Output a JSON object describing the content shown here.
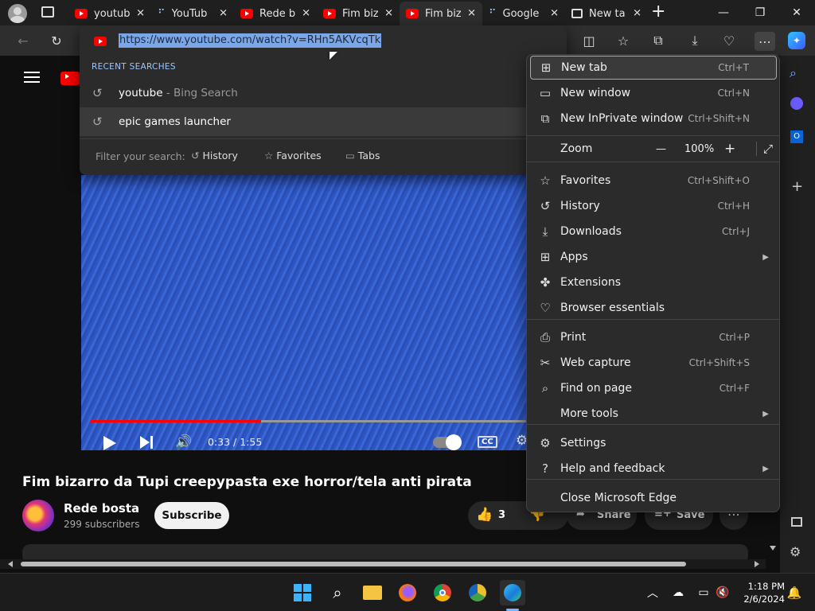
{
  "tabs": [
    {
      "label": "youtub",
      "icon": "youtube-icon"
    },
    {
      "label": "YouTub",
      "icon": "loading-icon"
    },
    {
      "label": "Rede b",
      "icon": "youtube-icon"
    },
    {
      "label": "Fim biz",
      "icon": "youtube-icon"
    },
    {
      "label": "Fim biz",
      "icon": "youtube-icon",
      "active": true
    },
    {
      "label": "Google",
      "icon": "loading-icon"
    },
    {
      "label": "New ta",
      "icon": "newtab-icon"
    }
  ],
  "address": {
    "url": "https://www.youtube.com/watch?v=RHn5AKVcqTk",
    "recent_header": "RECENT SEARCHES",
    "suggestions": [
      {
        "text": "youtube",
        "sub": "- Bing Search"
      },
      {
        "text": "epic games launcher",
        "sub": ""
      }
    ],
    "filter_label": "Filter your search:",
    "filters": [
      "History",
      "Favorites",
      "Tabs"
    ]
  },
  "video": {
    "time": "0:33 / 1:55",
    "progress": 0.39,
    "title": "Fim bizarro da Tupi creepypasta exe horror/tela anti pirata",
    "channel": "Rede bosta",
    "subscribers": "299 subscribers",
    "subscribe_label": "Subscribe",
    "likes": "3",
    "share_label": "Share",
    "save_label": "Save",
    "cc_label": "CC"
  },
  "menu": {
    "items": [
      {
        "label": "New tab",
        "shortcut": "Ctrl+T",
        "icon": "new-tab-icon",
        "glyph": "⊞"
      },
      {
        "label": "New window",
        "shortcut": "Ctrl+N",
        "icon": "new-window-icon",
        "glyph": "▭"
      },
      {
        "label": "New InPrivate window",
        "shortcut": "Ctrl+Shift+N",
        "icon": "inprivate-icon",
        "glyph": "⧉"
      },
      {
        "label": "Favorites",
        "shortcut": "Ctrl+Shift+O",
        "icon": "favorites-icon",
        "glyph": "☆"
      },
      {
        "label": "History",
        "shortcut": "Ctrl+H",
        "icon": "history-icon",
        "glyph": "↺"
      },
      {
        "label": "Downloads",
        "shortcut": "Ctrl+J",
        "icon": "downloads-icon",
        "glyph": "⤓"
      },
      {
        "label": "Apps",
        "shortcut": "",
        "icon": "apps-icon",
        "glyph": "⊞",
        "submenu": true
      },
      {
        "label": "Extensions",
        "shortcut": "",
        "icon": "extensions-icon",
        "glyph": "✤"
      },
      {
        "label": "Browser essentials",
        "shortcut": "",
        "icon": "browser-essentials-icon",
        "glyph": "♡"
      },
      {
        "label": "Print",
        "shortcut": "Ctrl+P",
        "icon": "print-icon",
        "glyph": "⎙"
      },
      {
        "label": "Web capture",
        "shortcut": "Ctrl+Shift+S",
        "icon": "web-capture-icon",
        "glyph": "✂"
      },
      {
        "label": "Find on page",
        "shortcut": "Ctrl+F",
        "icon": "find-icon",
        "glyph": "⌕"
      },
      {
        "label": "More tools",
        "shortcut": "",
        "icon": "",
        "glyph": "",
        "submenu": true
      },
      {
        "label": "Settings",
        "shortcut": "",
        "icon": "settings-icon",
        "glyph": "⚙"
      },
      {
        "label": "Help and feedback",
        "shortcut": "",
        "icon": "help-icon",
        "glyph": "?",
        "submenu": true
      },
      {
        "label": "Close Microsoft Edge",
        "shortcut": "",
        "icon": "",
        "glyph": ""
      }
    ],
    "zoom_label": "Zoom",
    "zoom_value": "100%",
    "zoom_minus": "—",
    "zoom_plus": "+"
  },
  "taskbar": {
    "time": "1:18 PM",
    "date": "2/6/2024"
  },
  "colors": {
    "accent": "#7ba7e8",
    "youtube_red": "#ff0000",
    "menu_bg": "#2b2b2b"
  }
}
